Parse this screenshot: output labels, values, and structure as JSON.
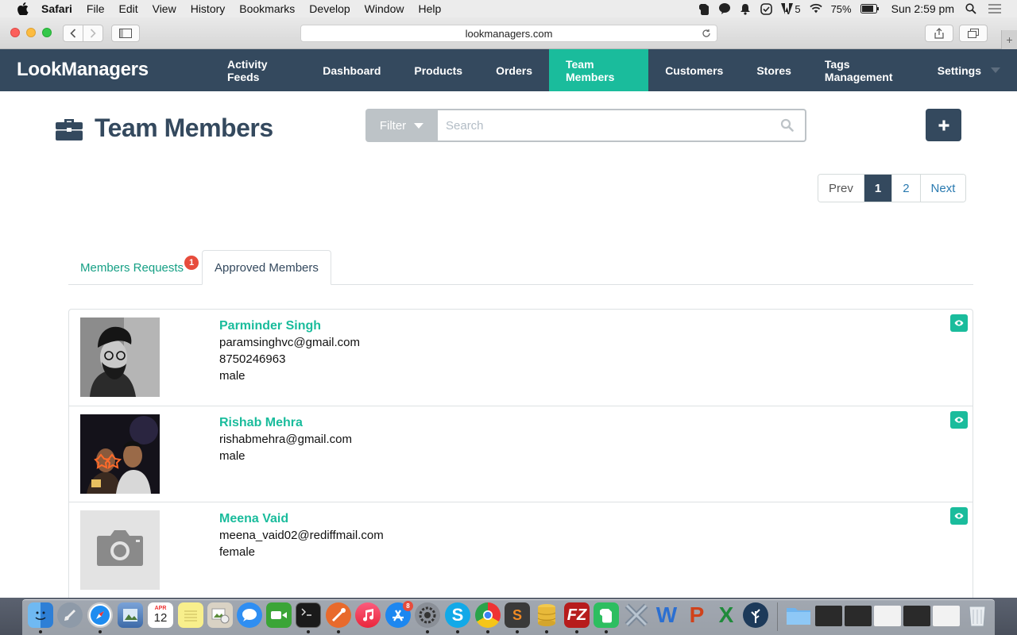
{
  "menubar": {
    "items": [
      "Safari",
      "File",
      "Edit",
      "View",
      "History",
      "Bookmarks",
      "Develop",
      "Window",
      "Help"
    ],
    "adobe_count": "5",
    "battery": "75%",
    "clock": "Sun 2:59 pm"
  },
  "browser": {
    "url": "lookmanagers.com"
  },
  "app": {
    "brand": "LookManagers",
    "nav": [
      "Activity Feeds",
      "Dashboard",
      "Products",
      "Orders",
      "Team Members",
      "Customers",
      "Stores",
      "Tags Management",
      "Settings"
    ],
    "active_nav": "Team Members",
    "accent": "#1abc9c",
    "primary": "#34495e"
  },
  "page": {
    "title": "Team Members",
    "filter_label": "Filter",
    "search_placeholder": "Search",
    "pagination": [
      "Prev",
      "1",
      "2",
      "Next"
    ],
    "current_page": "1",
    "tabs": {
      "requests": "Members Requests",
      "requests_badge": "1",
      "approved": "Approved Members"
    },
    "members": [
      {
        "name": "Parminder Singh",
        "email": "paramsinghvc@gmail.com",
        "phone": "8750246963",
        "gender": "male"
      },
      {
        "name": "Rishab Mehra",
        "email": "rishabmehra@gmail.com",
        "gender": "male"
      },
      {
        "name": "Meena Vaid",
        "email": "meena_vaid02@rediffmail.com",
        "gender": "female"
      }
    ]
  },
  "dock": {
    "calendar_month": "APR",
    "calendar_day": "12",
    "appstore_badge": "8"
  }
}
